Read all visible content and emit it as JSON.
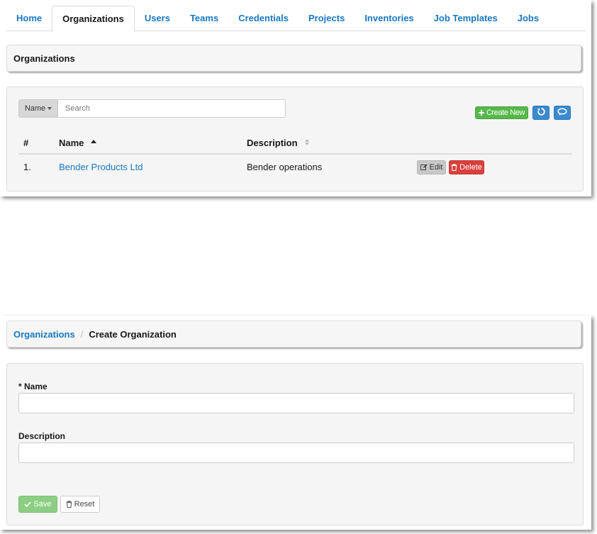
{
  "tabs": [
    {
      "label": "Home"
    },
    {
      "label": "Organizations"
    },
    {
      "label": "Users"
    },
    {
      "label": "Teams"
    },
    {
      "label": "Credentials"
    },
    {
      "label": "Projects"
    },
    {
      "label": "Inventories"
    },
    {
      "label": "Job Templates"
    },
    {
      "label": "Jobs"
    }
  ],
  "list_view": {
    "title": "Organizations",
    "search": {
      "field_label": "Name",
      "placeholder": "Search"
    },
    "create_label": "Create New",
    "columns": [
      "#",
      "Name",
      "Description"
    ],
    "rows": [
      {
        "index": "1.",
        "name": "Bender Products Ltd",
        "description": "Bender operations",
        "edit_label": "Edit",
        "delete_label": "Delete"
      }
    ]
  },
  "form_view": {
    "breadcrumb": {
      "parent": "Organizations",
      "separator": "/",
      "current": "Create Organization"
    },
    "name_label": "* Name",
    "description_label": "Description",
    "save_label": "Save",
    "reset_label": "Reset"
  },
  "colors": {
    "link": "#1778c3",
    "success": "#57b84a",
    "primary": "#3a8ad0",
    "danger": "#d9403c",
    "save_disabled": "#8ccf84"
  },
  "icons": [
    "plus-icon",
    "refresh-icon",
    "chat-icon",
    "edit-icon",
    "trash-icon",
    "check-icon",
    "sort-asc-icon",
    "sort-icon",
    "caret-down-icon"
  ]
}
